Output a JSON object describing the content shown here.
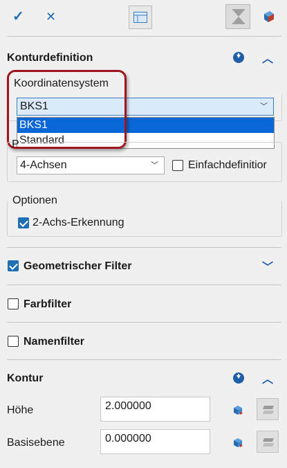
{
  "sections": {
    "konturdefinition": "Konturdefinition",
    "geometrischer_filter": "Geometrischer Filter",
    "farbfilter": "Farbfilter",
    "namenfilter": "Namenfilter",
    "kontur": "Kontur"
  },
  "koordinatensystem": {
    "label": "Koordinatensystem",
    "selected": "BKS1",
    "options": [
      "BKS1",
      "Standard"
    ]
  },
  "achsen": {
    "label_partial": "P",
    "selected": "4-Achsen",
    "einfachdefinition": "Einfachdefinitior"
  },
  "optionen": {
    "label": "Optionen",
    "zwei_achs": "2-Achs-Erkennung"
  },
  "kontur": {
    "hoehe_label": "Höhe",
    "hoehe_value": "2.000000",
    "basis_label": "Basisebene",
    "basis_value": "0.000000"
  },
  "colors": {
    "accent": "#1f6fb5",
    "selection": "#0a67d6",
    "highlight": "#a0141e"
  },
  "icons": [
    "check-icon",
    "close-icon",
    "table-icon",
    "filter-icon",
    "cube-icon",
    "download-circle-icon",
    "chevron-up-icon",
    "chevron-down-icon"
  ]
}
